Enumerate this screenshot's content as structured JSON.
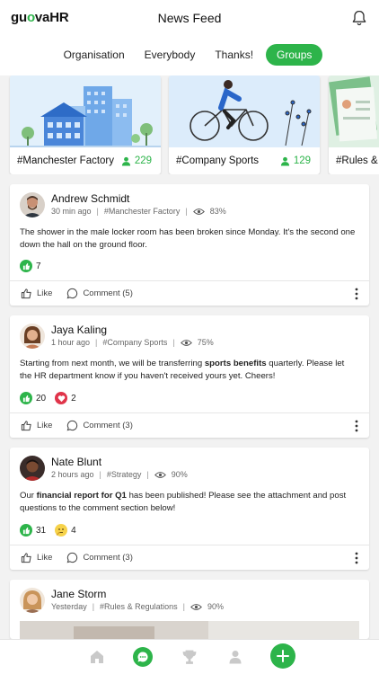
{
  "app": {
    "logo_prefix": "gu",
    "logo_accent": "o",
    "logo_suffix": "vaHR",
    "title": "News Feed",
    "accent_color": "#2db44a"
  },
  "tabs": [
    {
      "label": "Organisation",
      "active": false
    },
    {
      "label": "Everybody",
      "active": false
    },
    {
      "label": "Thanks!",
      "active": false
    },
    {
      "label": "Groups",
      "active": true
    }
  ],
  "groups": [
    {
      "name": "#Manchester Factory",
      "members": "229",
      "image": "factory-illustration"
    },
    {
      "name": "#Company Sports",
      "members": "129",
      "image": "cyclist-illustration"
    },
    {
      "name": "#Rules & R",
      "members": "",
      "image": "documents-illustration"
    }
  ],
  "posts": [
    {
      "author": "Andrew Schmidt",
      "time": "30 min ago",
      "group": "#Manchester Factory",
      "views": "83%",
      "text_parts": [
        {
          "t": "The shower in the male locker room has been broken since Monday. It's the second one down the hall on the ground floor.",
          "bold": false
        }
      ],
      "likes": "7",
      "hearts": "",
      "thinks": "",
      "like_label": "Like",
      "comment_label": "Comment (5)"
    },
    {
      "author": "Jaya Kaling",
      "time": "1 hour ago",
      "group": "#Company Sports",
      "views": "75%",
      "text_parts": [
        {
          "t": "Starting from next month, we will be transferring ",
          "bold": false
        },
        {
          "t": "sports benefits",
          "bold": true
        },
        {
          "t": " quarterly. Please let the HR department know if you haven't received yours yet. Cheers!",
          "bold": false
        }
      ],
      "likes": "20",
      "hearts": "2",
      "thinks": "",
      "like_label": "Like",
      "comment_label": "Comment (3)"
    },
    {
      "author": "Nate Blunt",
      "time": "2 hours ago",
      "group": "#Strategy",
      "views": "90%",
      "text_parts": [
        {
          "t": "Our ",
          "bold": false
        },
        {
          "t": "financial report for Q1",
          "bold": true
        },
        {
          "t": " has been published! Please see the attachment and post questions to the comment section below!",
          "bold": false
        }
      ],
      "likes": "31",
      "hearts": "",
      "thinks": "4",
      "like_label": "Like",
      "comment_label": "Comment (3)"
    },
    {
      "author": "Jane Storm",
      "time": "Yesterday",
      "group": "#Rules & Regulations",
      "views": "90%"
    }
  ],
  "bottom_nav": [
    {
      "icon": "home-icon",
      "active": false
    },
    {
      "icon": "chat-icon",
      "active": true
    },
    {
      "icon": "trophy-icon",
      "active": false
    },
    {
      "icon": "profile-icon",
      "active": false
    },
    {
      "icon": "plus-icon",
      "active": false
    }
  ]
}
